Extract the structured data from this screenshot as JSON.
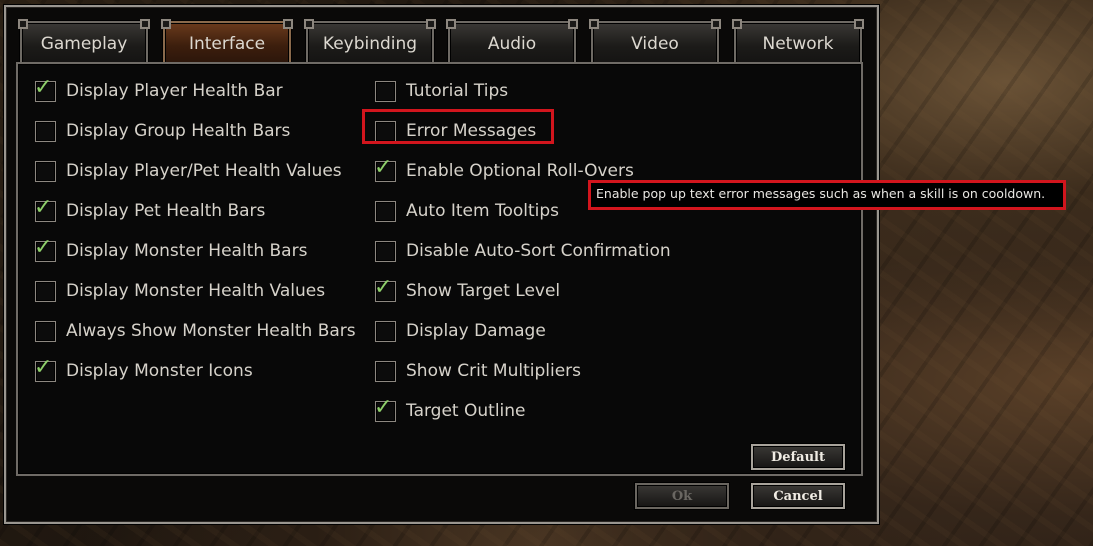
{
  "tabs": [
    {
      "label": "Gameplay",
      "active": false
    },
    {
      "label": "Interface",
      "active": true
    },
    {
      "label": "Keybinding",
      "active": false
    },
    {
      "label": "Audio",
      "active": false
    },
    {
      "label": "Video",
      "active": false
    },
    {
      "label": "Network",
      "active": false
    }
  ],
  "left_options": [
    {
      "label": "Display Player Health Bar",
      "checked": true
    },
    {
      "label": "Display Group Health Bars",
      "checked": false
    },
    {
      "label": "Display Player/Pet Health Values",
      "checked": false
    },
    {
      "label": "Display Pet Health Bars",
      "checked": true
    },
    {
      "label": "Display Monster Health Bars",
      "checked": true
    },
    {
      "label": "Display Monster Health Values",
      "checked": false
    },
    {
      "label": "Always Show Monster Health Bars",
      "checked": false
    },
    {
      "label": "Display Monster Icons",
      "checked": true
    }
  ],
  "right_options": [
    {
      "label": "Tutorial Tips",
      "checked": false
    },
    {
      "label": "Error Messages",
      "checked": false
    },
    {
      "label": "Enable Optional Roll-Overs",
      "checked": true
    },
    {
      "label": "Auto Item Tooltips",
      "checked": false
    },
    {
      "label": "Disable Auto-Sort Confirmation",
      "checked": false
    },
    {
      "label": "Show Target Level",
      "checked": true
    },
    {
      "label": "Display Damage",
      "checked": false
    },
    {
      "label": "Show Crit Multipliers",
      "checked": false
    },
    {
      "label": "Target Outline",
      "checked": true
    }
  ],
  "tooltip": {
    "text": "Enable pop up text error messages such as when a skill is on cooldown."
  },
  "buttons": {
    "default": "Default",
    "ok": "Ok",
    "cancel": "Cancel"
  },
  "colors": {
    "highlight": "#d2151d",
    "check": "#8fd06a",
    "active_tab": "#6a3a1c"
  }
}
